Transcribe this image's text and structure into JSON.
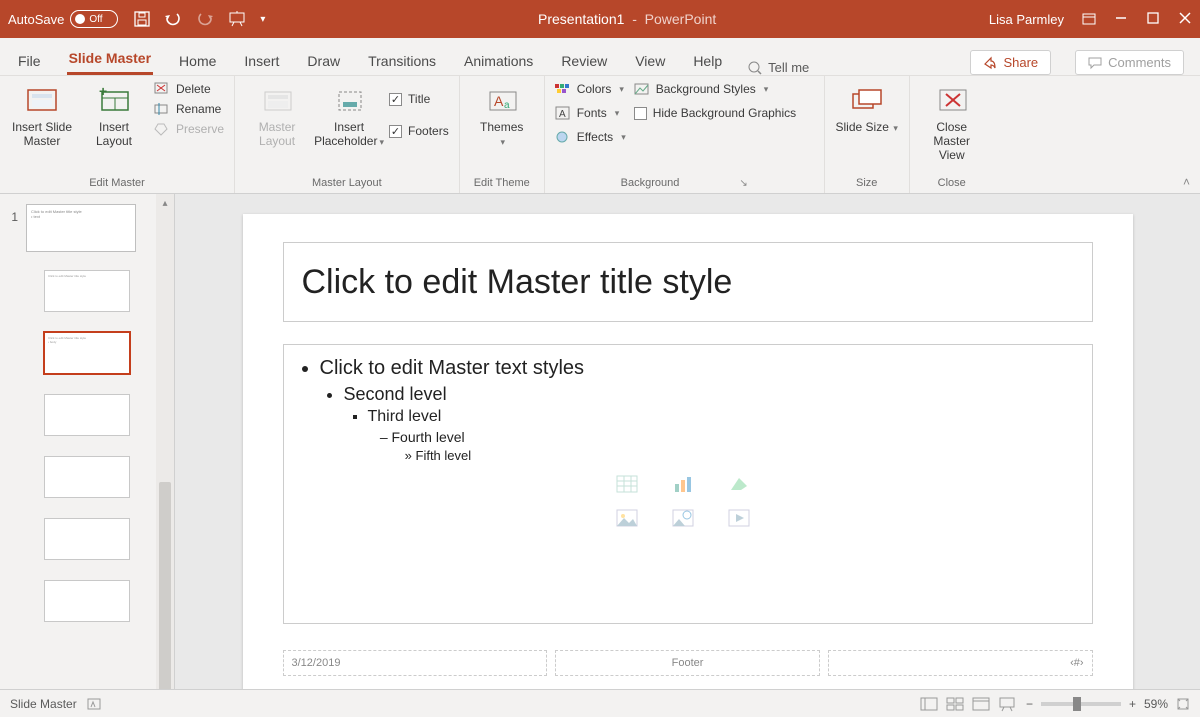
{
  "titlebar": {
    "autosave_label": "AutoSave",
    "autosave_state": "Off",
    "doc_name": "Presentation1",
    "app_name": "PowerPoint",
    "user": "Lisa Parmley"
  },
  "tabs": {
    "items": [
      "File",
      "Slide Master",
      "Home",
      "Insert",
      "Draw",
      "Transitions",
      "Animations",
      "Review",
      "View",
      "Help"
    ],
    "active_index": 1,
    "tell_me": "Tell me",
    "share": "Share",
    "comments": "Comments"
  },
  "ribbon": {
    "edit_master": {
      "label": "Edit Master",
      "insert_slide_master": "Insert Slide Master",
      "insert_layout": "Insert Layout",
      "delete": "Delete",
      "rename": "Rename",
      "preserve": "Preserve"
    },
    "master_layout": {
      "label": "Master Layout",
      "master_layout_btn": "Master Layout",
      "insert_placeholder": "Insert Placeholder",
      "title_chk": "Title",
      "footers_chk": "Footers"
    },
    "edit_theme": {
      "label": "Edit Theme",
      "themes": "Themes"
    },
    "background": {
      "label": "Background",
      "colors": "Colors",
      "fonts": "Fonts",
      "effects": "Effects",
      "bg_styles": "Background Styles",
      "hide_bg": "Hide Background Graphics"
    },
    "size": {
      "label": "Size",
      "slide_size": "Slide Size"
    },
    "close": {
      "label": "Close",
      "close_btn": "Close Master View"
    }
  },
  "thumbs": {
    "slide_number": "1"
  },
  "slide": {
    "title": "Click to edit Master title style",
    "levels": [
      "Click to edit Master text styles",
      "Second level",
      "Third level",
      "Fourth level",
      "Fifth level"
    ],
    "date": "3/12/2019",
    "footer": "Footer",
    "pagenum": "‹#›"
  },
  "status": {
    "mode": "Slide Master",
    "zoom": "59%"
  }
}
